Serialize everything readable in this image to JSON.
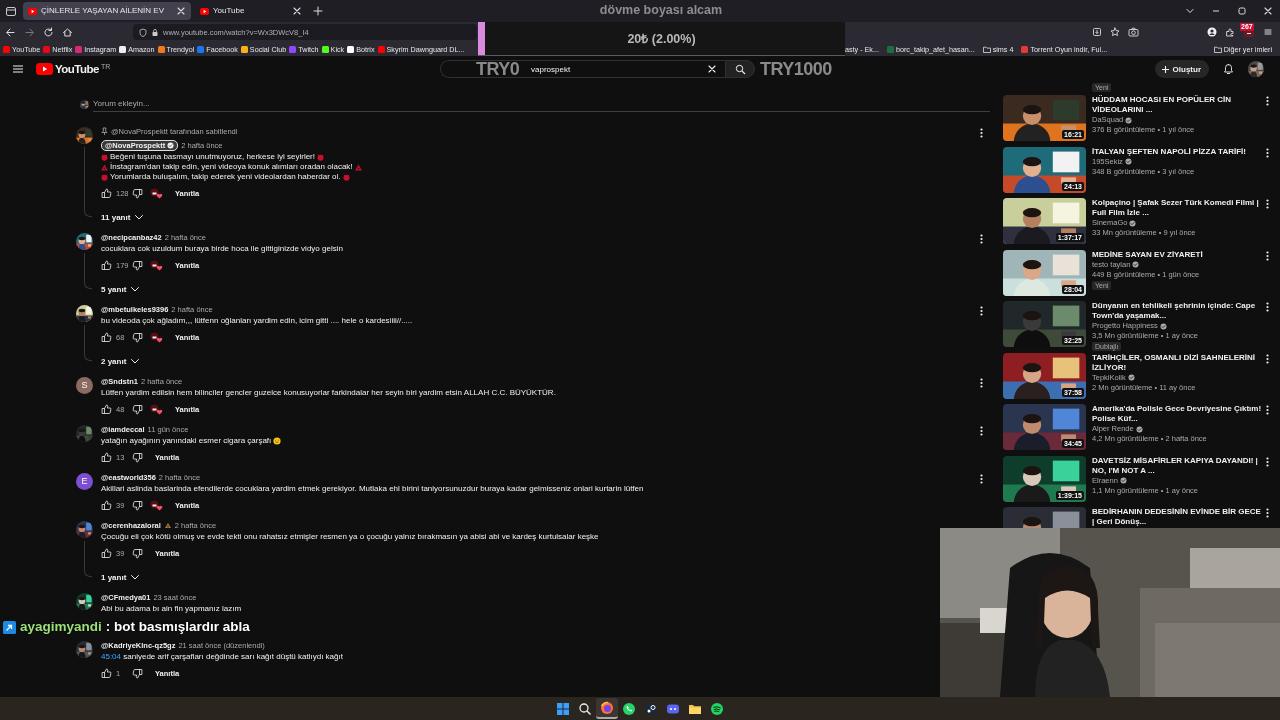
{
  "browser": {
    "tabs": [
      {
        "title": "ÇİNLERLE YAŞAYAN AİLENİN EV",
        "selected": true
      },
      {
        "title": "YouTube",
        "selected": false
      }
    ],
    "url": "www.youtube.com/watch?v=Wx3DWcV8_I4",
    "extension_badge": "267",
    "bookmarks_left": [
      {
        "label": "YouTube",
        "kind": "site",
        "color": "#ff0000"
      },
      {
        "label": "Netflix",
        "kind": "site",
        "color": "#e50914"
      },
      {
        "label": "Instagram",
        "kind": "site",
        "color": "#d62976"
      },
      {
        "label": "Amazon",
        "kind": "site",
        "color": "#eeeeee"
      },
      {
        "label": "Trendyol",
        "kind": "site",
        "color": "#f27a1a"
      },
      {
        "label": "Facebook",
        "kind": "site",
        "color": "#1877f2"
      },
      {
        "label": "Social Club",
        "kind": "site",
        "color": "#fcaf17"
      },
      {
        "label": "Twitch",
        "kind": "site",
        "color": "#9146ff"
      },
      {
        "label": "Kick",
        "kind": "site",
        "color": "#53fc18"
      },
      {
        "label": "Botrix",
        "kind": "site",
        "color": "#ffffff"
      },
      {
        "label": "Skyrim Dawnguard DL...",
        "kind": "site",
        "color": "#ff0000"
      }
    ],
    "bookmarks_right": [
      {
        "label": "asty - Ek...",
        "kind": "plain"
      },
      {
        "label": "borc_takip_afet_hasan...",
        "kind": "site",
        "color": "#1d6f42"
      },
      {
        "label": "sims 4",
        "kind": "folder"
      },
      {
        "label": "Torrent Oyun indir, Ful...",
        "kind": "site",
        "color": "#e53935"
      },
      {
        "label": "Diğer yer imleri",
        "kind": "folder"
      }
    ]
  },
  "goal": {
    "title": "dövme boyası alcam",
    "amount": "20₺ (2.00%)",
    "level": 0.02,
    "start_label": "TRY0",
    "end_label": "TRY1000"
  },
  "youtube": {
    "logo": "YouTube",
    "region": "TR",
    "search_value": "vaprospekt",
    "create_label": "Oluştur"
  },
  "comments": {
    "placeholder": "Yorum ekleyin...",
    "items": [
      {
        "avatar": {
          "kind": "picture"
        },
        "pinned_by": "@NovaProspektt tarafından sabitlendi",
        "author": "@NovaProspektt",
        "creator": true,
        "time": "2 hafta önce",
        "lines": [
          {
            "text": "Beğeni tuşuna basmayı unutmuyoruz, herkese iyi seyirler!",
            "decorated": true
          },
          {
            "text": "İnstagram'dan takip edin, yeni videoya konuk alımları oradan olacak!",
            "decorated": true
          },
          {
            "text": "Yorumlarda buluşalım, takip ederek yeni videolardan haberdar ol.",
            "decorated": true
          }
        ],
        "likes": "128",
        "hearted": true,
        "reply_label": "Yanıtla",
        "replies": "11 yanıt",
        "menu": true
      },
      {
        "avatar": {
          "kind": "picture"
        },
        "author": "@necipcanbaz42",
        "creator": false,
        "time": "2 hafta önce",
        "lines": [
          {
            "text": "cocuklara cok uzuldum buraya birde hoca ile gittiginizde vidyo gelsin",
            "decorated": false
          }
        ],
        "likes": "179",
        "hearted": true,
        "reply_label": "Yanıtla",
        "replies": "5 yanıt",
        "menu": true
      },
      {
        "avatar": {
          "kind": "picture"
        },
        "author": "@mbetulkeles9396",
        "creator": false,
        "time": "2 hafta önce",
        "lines": [
          {
            "text": "bu videoda çok ağladım,,, lütfenn oğlanları yardim edin, icim gitti .... hele o kardesiiii//.....",
            "decorated": false
          }
        ],
        "likes": "68",
        "hearted": true,
        "reply_label": "Yanıtla",
        "replies": "2 yanıt",
        "menu": true
      },
      {
        "avatar": {
          "kind": "letter",
          "letter": "S",
          "color": "#8b6a62"
        },
        "author": "@Sndstn1",
        "creator": false,
        "time": "2 hafta önce",
        "lines": [
          {
            "text": "Lütfen yardim edilsin hem bilinciler gencler guzelce konusuyorlar farkindalar her seyin biri yardim etsin ALLAH C.C. BÜYÜKTÜR.",
            "decorated": false
          }
        ],
        "likes": "48",
        "hearted": true,
        "reply_label": "Yanıtla",
        "menu": true
      },
      {
        "avatar": {
          "kind": "picture"
        },
        "author": "@iamdeccal",
        "creator": false,
        "time": "11 gün önce",
        "lines": [
          {
            "text": "yatağın ayağının yanındaki esmer cigara çarşafı",
            "decorated": false
          }
        ],
        "emoji": true,
        "likes": "13",
        "hearted": false,
        "reply_label": "Yanıtla",
        "menu": true
      },
      {
        "avatar": {
          "kind": "letter",
          "letter": "E",
          "color": "#7b4fd0"
        },
        "author": "@eastworld356",
        "creator": false,
        "time": "2 hafta önce",
        "lines": [
          {
            "text": "Akillari aslinda baslarinda efendilerde cocuklara yardim etmek gerekiyor. Mutlaka ehl birini taniyorsunuzdur buraya kadar gelmisseniz onlari kurtarin lütfen",
            "decorated": false
          }
        ],
        "likes": "39",
        "hearted": true,
        "reply_label": "Yanıtla",
        "menu": true
      },
      {
        "avatar": {
          "kind": "picture"
        },
        "author": "@cerenhazaloral",
        "author_badge": true,
        "creator": false,
        "time": "2 hafta önce",
        "lines": [
          {
            "text": "Çocuğu eli çok kötü olmuş ve evde tekti onu rahatsız etmişler resmen ya o çocuğu yalnız bırakmasın ya abisi abi ve kardeş kurtulsalar keşke",
            "decorated": false
          }
        ],
        "likes": "39",
        "hearted": false,
        "reply_label": "Yanıtla",
        "replies": "1 yanıt",
        "menu": false
      },
      {
        "avatar": {
          "kind": "picture"
        },
        "author": "@CFmedya01",
        "creator": false,
        "time": "23 saat önce",
        "lines": [
          {
            "text": "Abi bu adama bı ain fln yapmanız lazım",
            "decorated": false
          }
        ],
        "menu": false
      },
      {
        "avatar": {
          "kind": "picture"
        },
        "author": "@KadriyeKlnc-qz5gz",
        "creator": false,
        "time": "21 saat önce (düzenlendi)",
        "timestamp": "45:04",
        "lines": [
          {
            "text": "saniyede arif çarşafları değdinde sarı kağıt düştü katlıydı kağıt",
            "decorated": false
          }
        ],
        "likes": "1",
        "hearted": false,
        "reply_label": "Yanıtla",
        "menu": false
      }
    ]
  },
  "sidebar": {
    "top_badge": "Yeni",
    "videos": [
      {
        "title": "HÜDDAM HOCASI EN POPÜLER CİN VİDEOLARINI ...",
        "channel": "DaSquad",
        "verified": true,
        "meta": "376 B görüntüleme • 1 yıl önce",
        "duration": "16:21"
      },
      {
        "title": "İTALYAN ŞEFTEN NAPOLİ PİZZA TARİFİ!",
        "channel": "195Sekiz",
        "verified": true,
        "meta": "348 B görüntüleme • 3 yıl önce",
        "duration": "24:13"
      },
      {
        "title": "Kolpaçino | Şafak Sezer Türk Komedi Filmi | Full Film İzle ...",
        "channel": "SinemaGo",
        "verified": true,
        "meta": "33 Mn görüntüleme • 9 yıl önce",
        "duration": "1:37:17"
      },
      {
        "title": "MEDİNE SAYAN EV ZİYARETİ",
        "channel": "testo taylan",
        "verified": true,
        "meta": "449 B görüntüleme • 1 gün önce",
        "badge": "Yeni",
        "duration": "28:04"
      },
      {
        "title": "Dünyanın en tehlikeli şehrinin içinde: Cape Town'da yaşamak...",
        "channel": "Progetto Happiness",
        "verified": true,
        "meta": "3,5 Mn görüntüleme • 1 ay önce",
        "badge": "Dublajlı",
        "duration": "32:25"
      },
      {
        "title": "TARİHÇİLER, OSMANLI DİZİ SAHNELERİNİ İZLİYOR!",
        "channel": "TepkiKolik",
        "verified": true,
        "meta": "2 Mn görüntüleme • 11 ay önce",
        "duration": "37:58"
      },
      {
        "title": "Amerika'da Polisle Gece Devriyesine Çıktım! Polise Küf...",
        "channel": "Alper Rende",
        "verified": true,
        "meta": "4,2 Mn görüntüleme • 2 hafta önce",
        "duration": "34:45"
      },
      {
        "title": "DAVETSİZ MİSAFİRLER KAPIYA DAYANDI! | NO, I'M NOT A ...",
        "channel": "Elraenn",
        "verified": true,
        "meta": "1,1 Mn görüntüleme • 1 ay önce",
        "duration": "1:39:15"
      },
      {
        "title": "BEDİRHANIN DEDESİNİN EVİNDE BİR GECE | Geri Dönüş..."
      }
    ]
  },
  "chat": {
    "user": "ayagimyandi",
    "message": ": bot basmışlardır abla"
  },
  "webcam": {
    "kind": "picture"
  },
  "taskbar": [
    {
      "kind": "start",
      "selected": false
    },
    {
      "kind": "search",
      "selected": false
    },
    {
      "kind": "browser",
      "selected": true
    },
    {
      "kind": "chat",
      "selected": false
    },
    {
      "kind": "launcher",
      "selected": false
    },
    {
      "kind": "voice",
      "selected": false
    },
    {
      "kind": "folder",
      "selected": false
    },
    {
      "kind": "music",
      "selected": false
    }
  ]
}
